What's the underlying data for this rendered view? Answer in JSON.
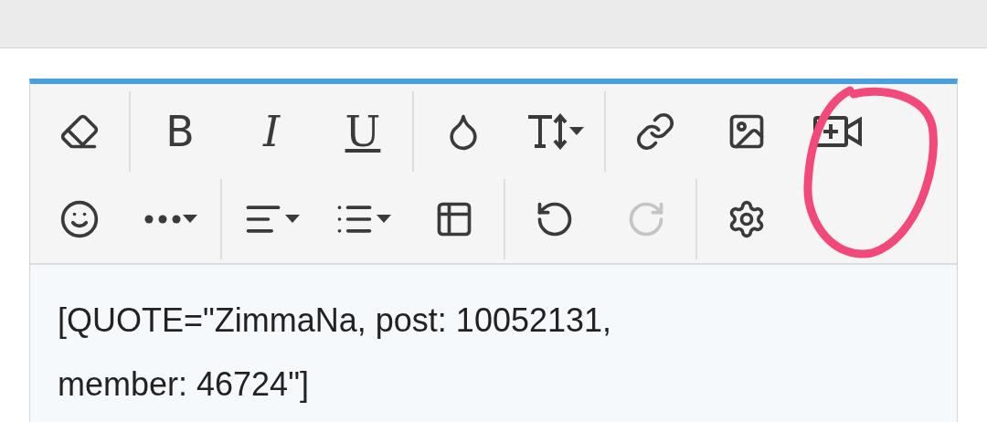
{
  "toolbar": {
    "rows": [
      {
        "groups": [
          [
            {
              "kind": "icon",
              "disabled": false,
              "dropdown": false
            }
          ],
          [
            {
              "kind": "letter",
              "label": "B",
              "disabled": false,
              "dropdown": false
            },
            {
              "kind": "letter",
              "label": "I",
              "disabled": false,
              "dropdown": false
            },
            {
              "kind": "letter",
              "label": "U",
              "disabled": false,
              "dropdown": false
            }
          ],
          [
            {
              "kind": "icon",
              "disabled": false,
              "dropdown": false
            },
            {
              "kind": "icon",
              "disabled": false,
              "dropdown": true
            }
          ],
          [
            {
              "kind": "icon",
              "disabled": false,
              "dropdown": false
            },
            {
              "kind": "icon",
              "disabled": false,
              "dropdown": false
            },
            {
              "kind": "icon",
              "disabled": false,
              "dropdown": false
            }
          ]
        ]
      },
      {
        "groups": [
          [
            {
              "kind": "icon",
              "disabled": false,
              "dropdown": false
            },
            {
              "kind": "icon",
              "disabled": false,
              "dropdown": true
            }
          ],
          [
            {
              "kind": "icon",
              "disabled": false,
              "dropdown": true
            },
            {
              "kind": "icon",
              "disabled": false,
              "dropdown": true
            },
            {
              "kind": "icon",
              "disabled": false,
              "dropdown": false
            }
          ],
          [
            {
              "kind": "icon",
              "disabled": false,
              "dropdown": false
            },
            {
              "kind": "icon",
              "disabled": true,
              "dropdown": false
            }
          ],
          [
            {
              "kind": "icon",
              "disabled": false,
              "dropdown": false
            }
          ]
        ]
      }
    ]
  },
  "editor": {
    "value": "[QUOTE=\"ZimmaNa, post: 10052131, member: 46724\"]"
  }
}
